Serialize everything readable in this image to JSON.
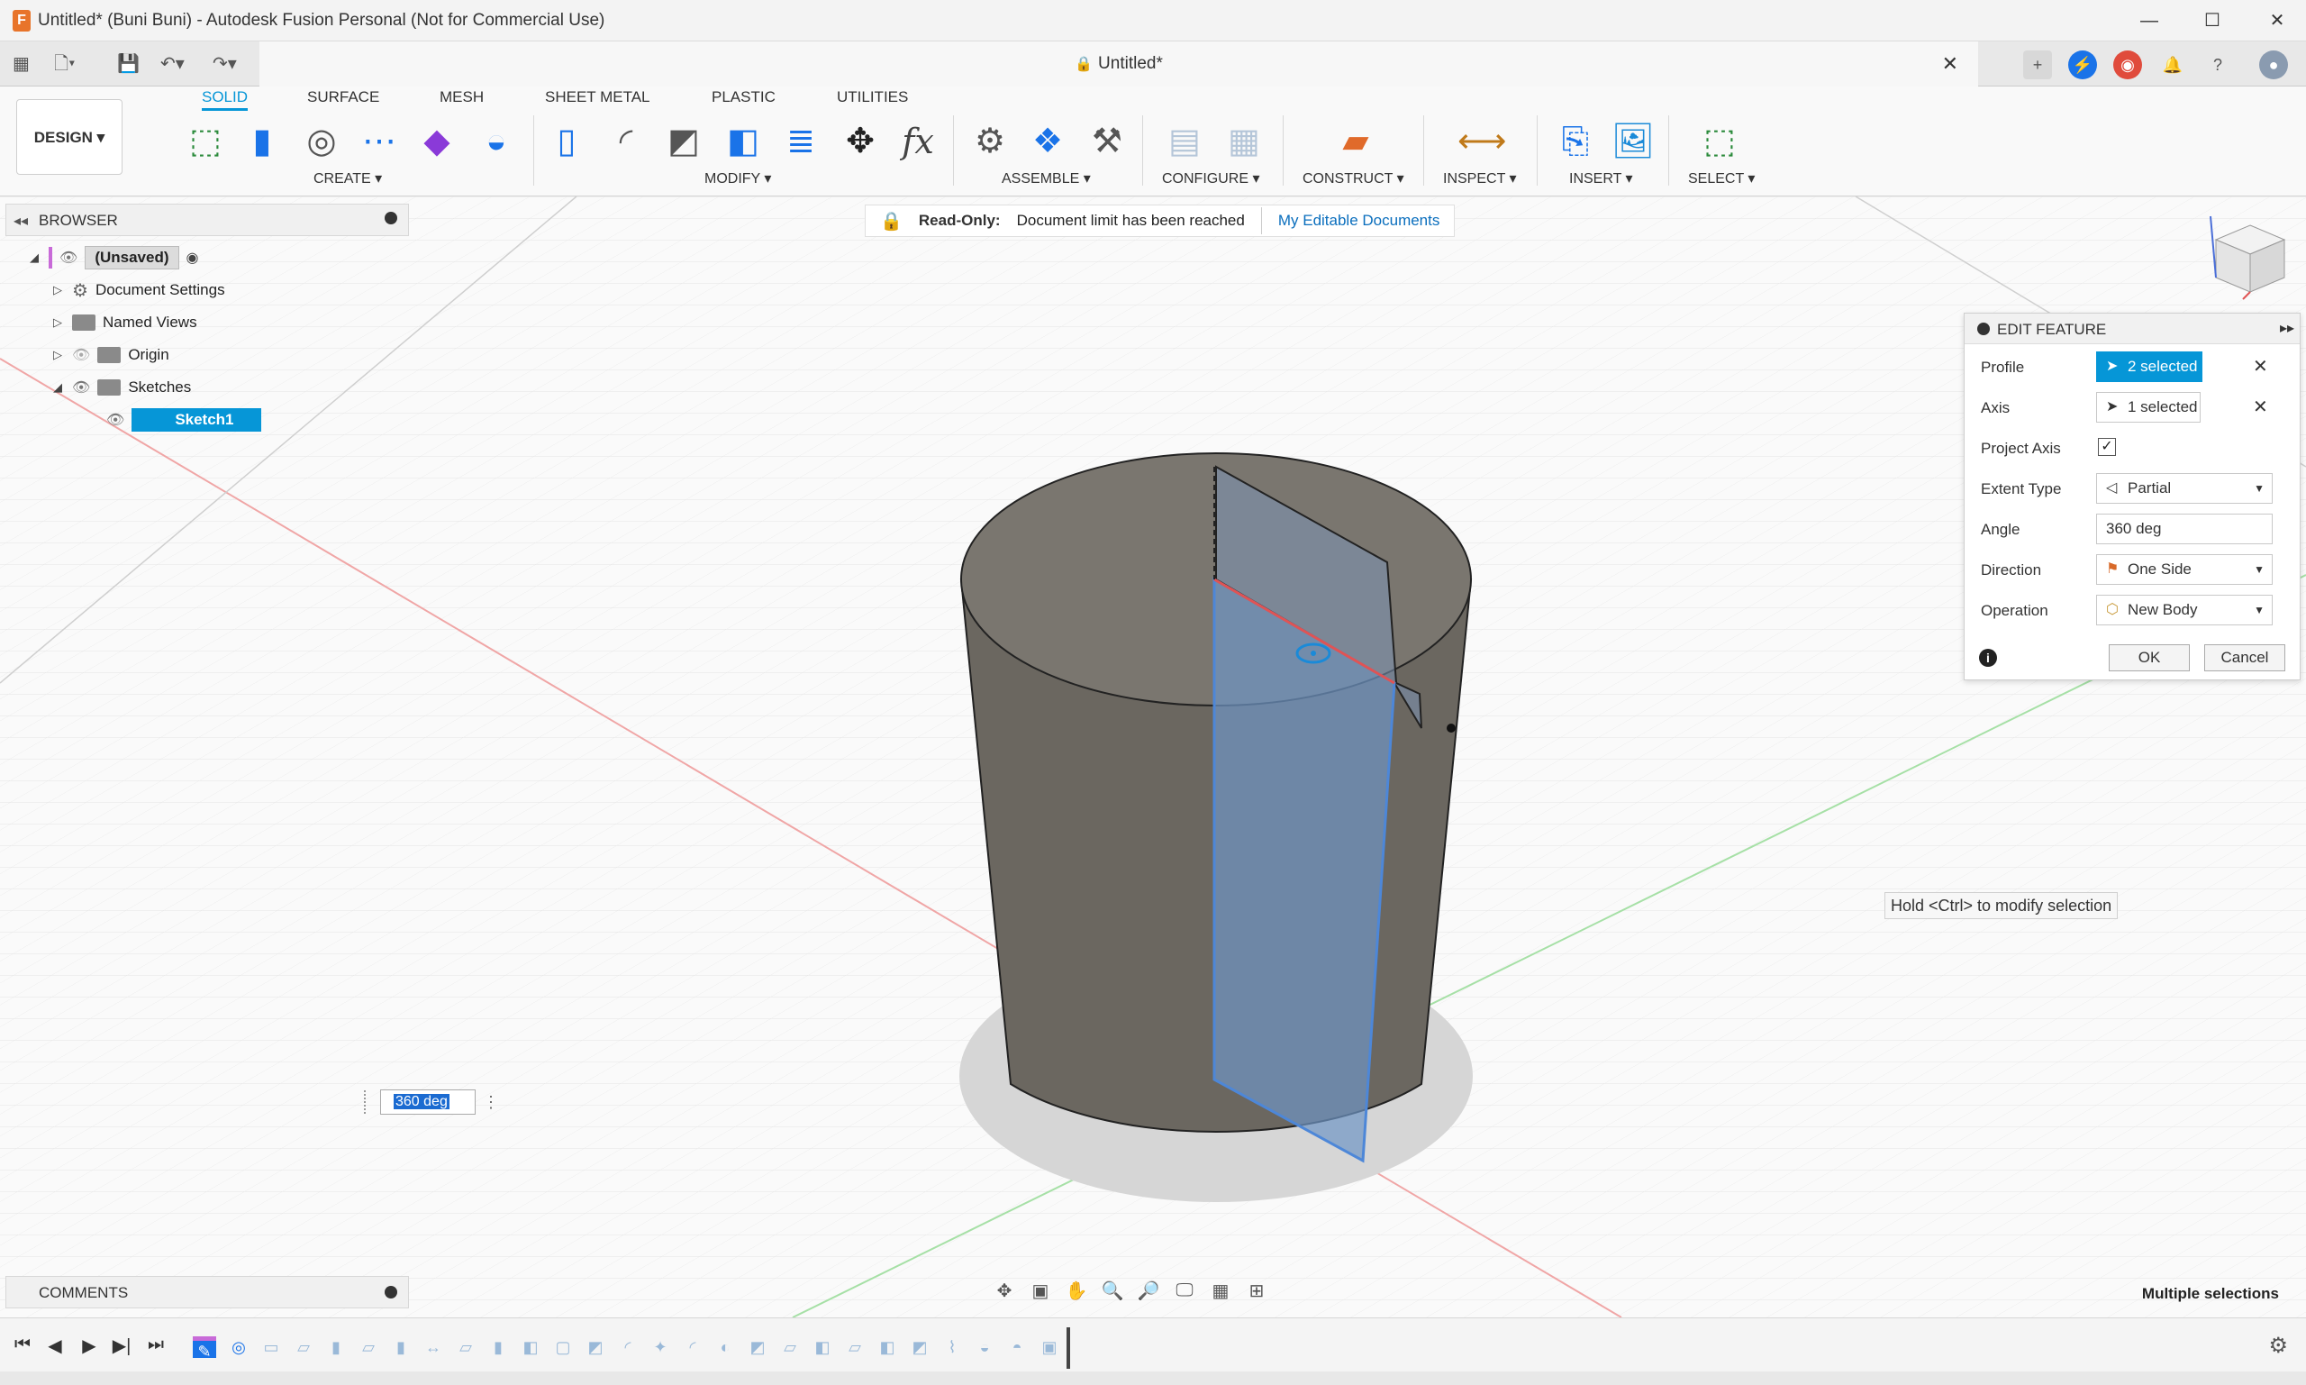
{
  "window": {
    "title": "Untitled* (Buni Buni) - Autodesk Fusion Personal (Not for Commercial Use)",
    "app_icon": "F"
  },
  "tabs": {
    "doc_title": "Untitled*"
  },
  "toolbar": {
    "design_label": "DESIGN",
    "workspace_tabs": [
      "SOLID",
      "SURFACE",
      "MESH",
      "SHEET METAL",
      "PLASTIC",
      "UTILITIES"
    ],
    "groups": {
      "create": "CREATE",
      "modify": "MODIFY",
      "assemble": "ASSEMBLE",
      "configure": "CONFIGURE",
      "construct": "CONSTRUCT",
      "inspect": "INSPECT",
      "insert": "INSERT",
      "select": "SELECT"
    }
  },
  "banner": {
    "read_only": "Read-Only:",
    "message": "Document limit has been reached",
    "link": "My Editable Documents"
  },
  "browser": {
    "title": "BROWSER",
    "root": "(Unsaved)",
    "items": [
      "Document Settings",
      "Named Views",
      "Origin",
      "Sketches"
    ],
    "sketch": "Sketch1"
  },
  "edit_feature": {
    "title": "EDIT FEATURE",
    "profile_label": "Profile",
    "profile_value": "2 selected",
    "axis_label": "Axis",
    "axis_value": "1 selected",
    "project_axis_label": "Project Axis",
    "project_axis_checked": "✓",
    "extent_type_label": "Extent Type",
    "extent_type_value": "Partial",
    "angle_label": "Angle",
    "angle_value": "360 deg",
    "direction_label": "Direction",
    "direction_value": "One Side",
    "operation_label": "Operation",
    "operation_value": "New Body",
    "ok": "OK",
    "cancel": "Cancel"
  },
  "viewport": {
    "tooltip": "Hold <Ctrl> to modify selection",
    "angle_input": "360 deg"
  },
  "comments": {
    "title": "COMMENTS"
  },
  "status": {
    "multiple_selections": "Multiple selections"
  },
  "colors": {
    "accent": "#0696d7",
    "cylinder": "#6b6760",
    "cylinder_top": "#7a766f",
    "plane": "#6f95c4",
    "red_axis": "#e05454"
  }
}
